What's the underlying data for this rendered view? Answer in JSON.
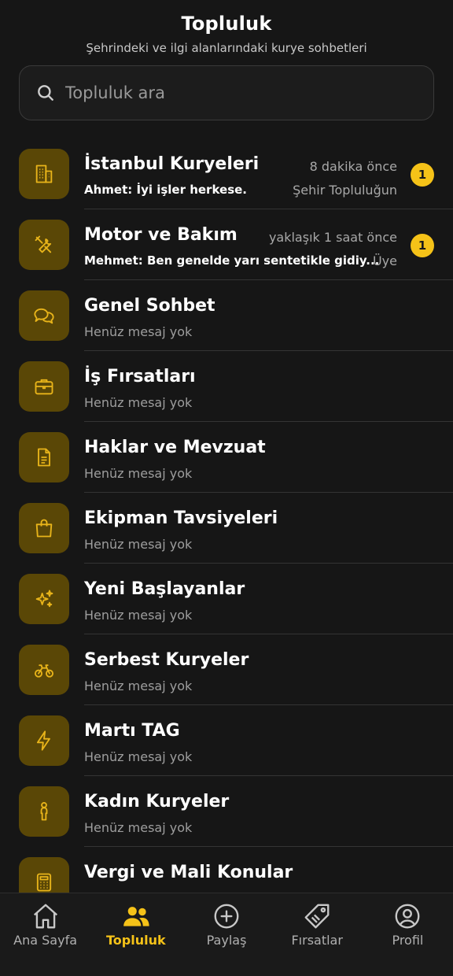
{
  "header": {
    "title": "Topluluk",
    "subtitle": "Şehrindeki ve ilgi alanlarındaki kurye sohbetleri"
  },
  "search": {
    "placeholder": "Topluluk ara",
    "value": ""
  },
  "communities": [
    {
      "name": "İstanbul Kuryeleri",
      "last_message": "Ahmet: İyi işler herkese.",
      "time": "8 dakika önce",
      "tag": "Şehir Topluluğun",
      "badge": "1",
      "icon": "building-icon"
    },
    {
      "name": "Motor ve Bakım",
      "last_message": "Mehmet: Ben genelde yarı sentetikle gidiy...",
      "time": "yaklaşık 1 saat önce",
      "tag": "Üye",
      "badge": "1",
      "icon": "tools-icon"
    },
    {
      "name": "Genel Sohbet",
      "last_message": "Henüz mesaj yok",
      "icon": "chat-icon"
    },
    {
      "name": "İş Fırsatları",
      "last_message": "Henüz mesaj yok",
      "icon": "briefcase-icon"
    },
    {
      "name": "Haklar ve Mevzuat",
      "last_message": "Henüz mesaj yok",
      "icon": "document-icon"
    },
    {
      "name": "Ekipman Tavsiyeleri",
      "last_message": "Henüz mesaj yok",
      "icon": "shopping-bag-icon"
    },
    {
      "name": "Yeni Başlayanlar",
      "last_message": "Henüz mesaj yok",
      "icon": "sparkles-icon"
    },
    {
      "name": "Serbest Kuryeler",
      "last_message": "Henüz mesaj yok",
      "icon": "bicycle-icon"
    },
    {
      "name": "Martı TAG",
      "last_message": "Henüz mesaj yok",
      "icon": "lightning-icon"
    },
    {
      "name": "Kadın Kuryeler",
      "last_message": "Henüz mesaj yok",
      "icon": "woman-icon"
    },
    {
      "name": "Vergi ve Mali Konular",
      "last_message": "",
      "icon": "calculator-icon"
    }
  ],
  "tabbar": {
    "tabs": [
      {
        "label": "Ana Sayfa",
        "icon": "home-icon"
      },
      {
        "label": "Topluluk",
        "icon": "users-icon",
        "active": true
      },
      {
        "label": "Paylaş",
        "icon": "plus-circle-icon"
      },
      {
        "label": "Fırsatlar",
        "icon": "tag-icon"
      },
      {
        "label": "Profil",
        "icon": "profile-icon"
      }
    ]
  },
  "colors": {
    "accent": "#f5c218",
    "background": "#161616",
    "avatar_bg": "#5a4706"
  }
}
